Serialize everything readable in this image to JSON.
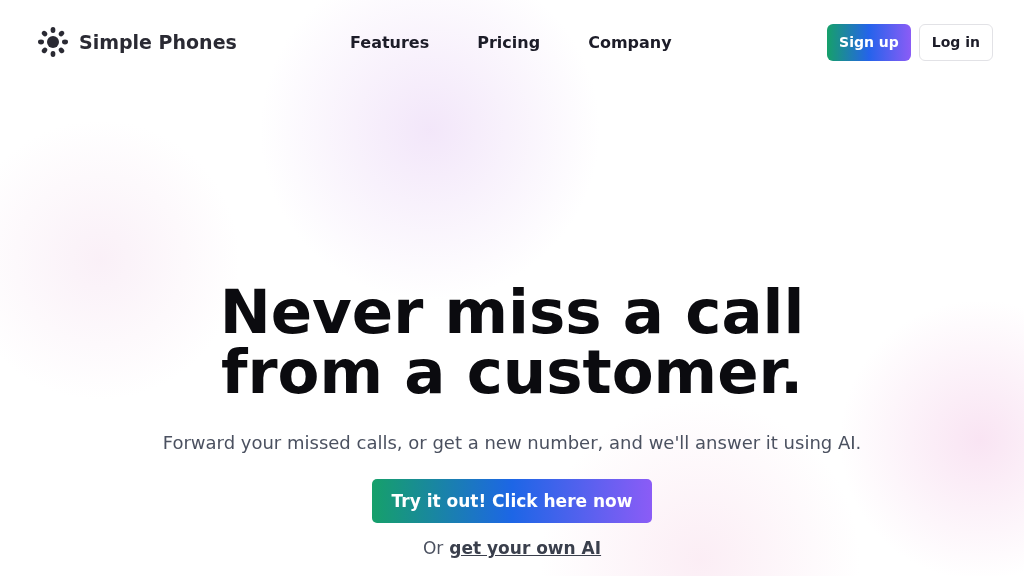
{
  "brand": {
    "name": "Simple Phones"
  },
  "nav": [
    {
      "label": "Features"
    },
    {
      "label": "Pricing"
    },
    {
      "label": "Company"
    }
  ],
  "actions": [
    {
      "label": "Sign up",
      "kind": "primary"
    },
    {
      "label": "Log in",
      "kind": "secondary"
    }
  ],
  "hero": {
    "title_lines": [
      "Never miss a call",
      "from a customer."
    ],
    "subtitle": "Forward your missed calls, or get a new number, and we'll answer it using AI.",
    "cta": "Try it out! Click here now",
    "alt_prefix": "Or",
    "alt_link": "get your own AI"
  }
}
